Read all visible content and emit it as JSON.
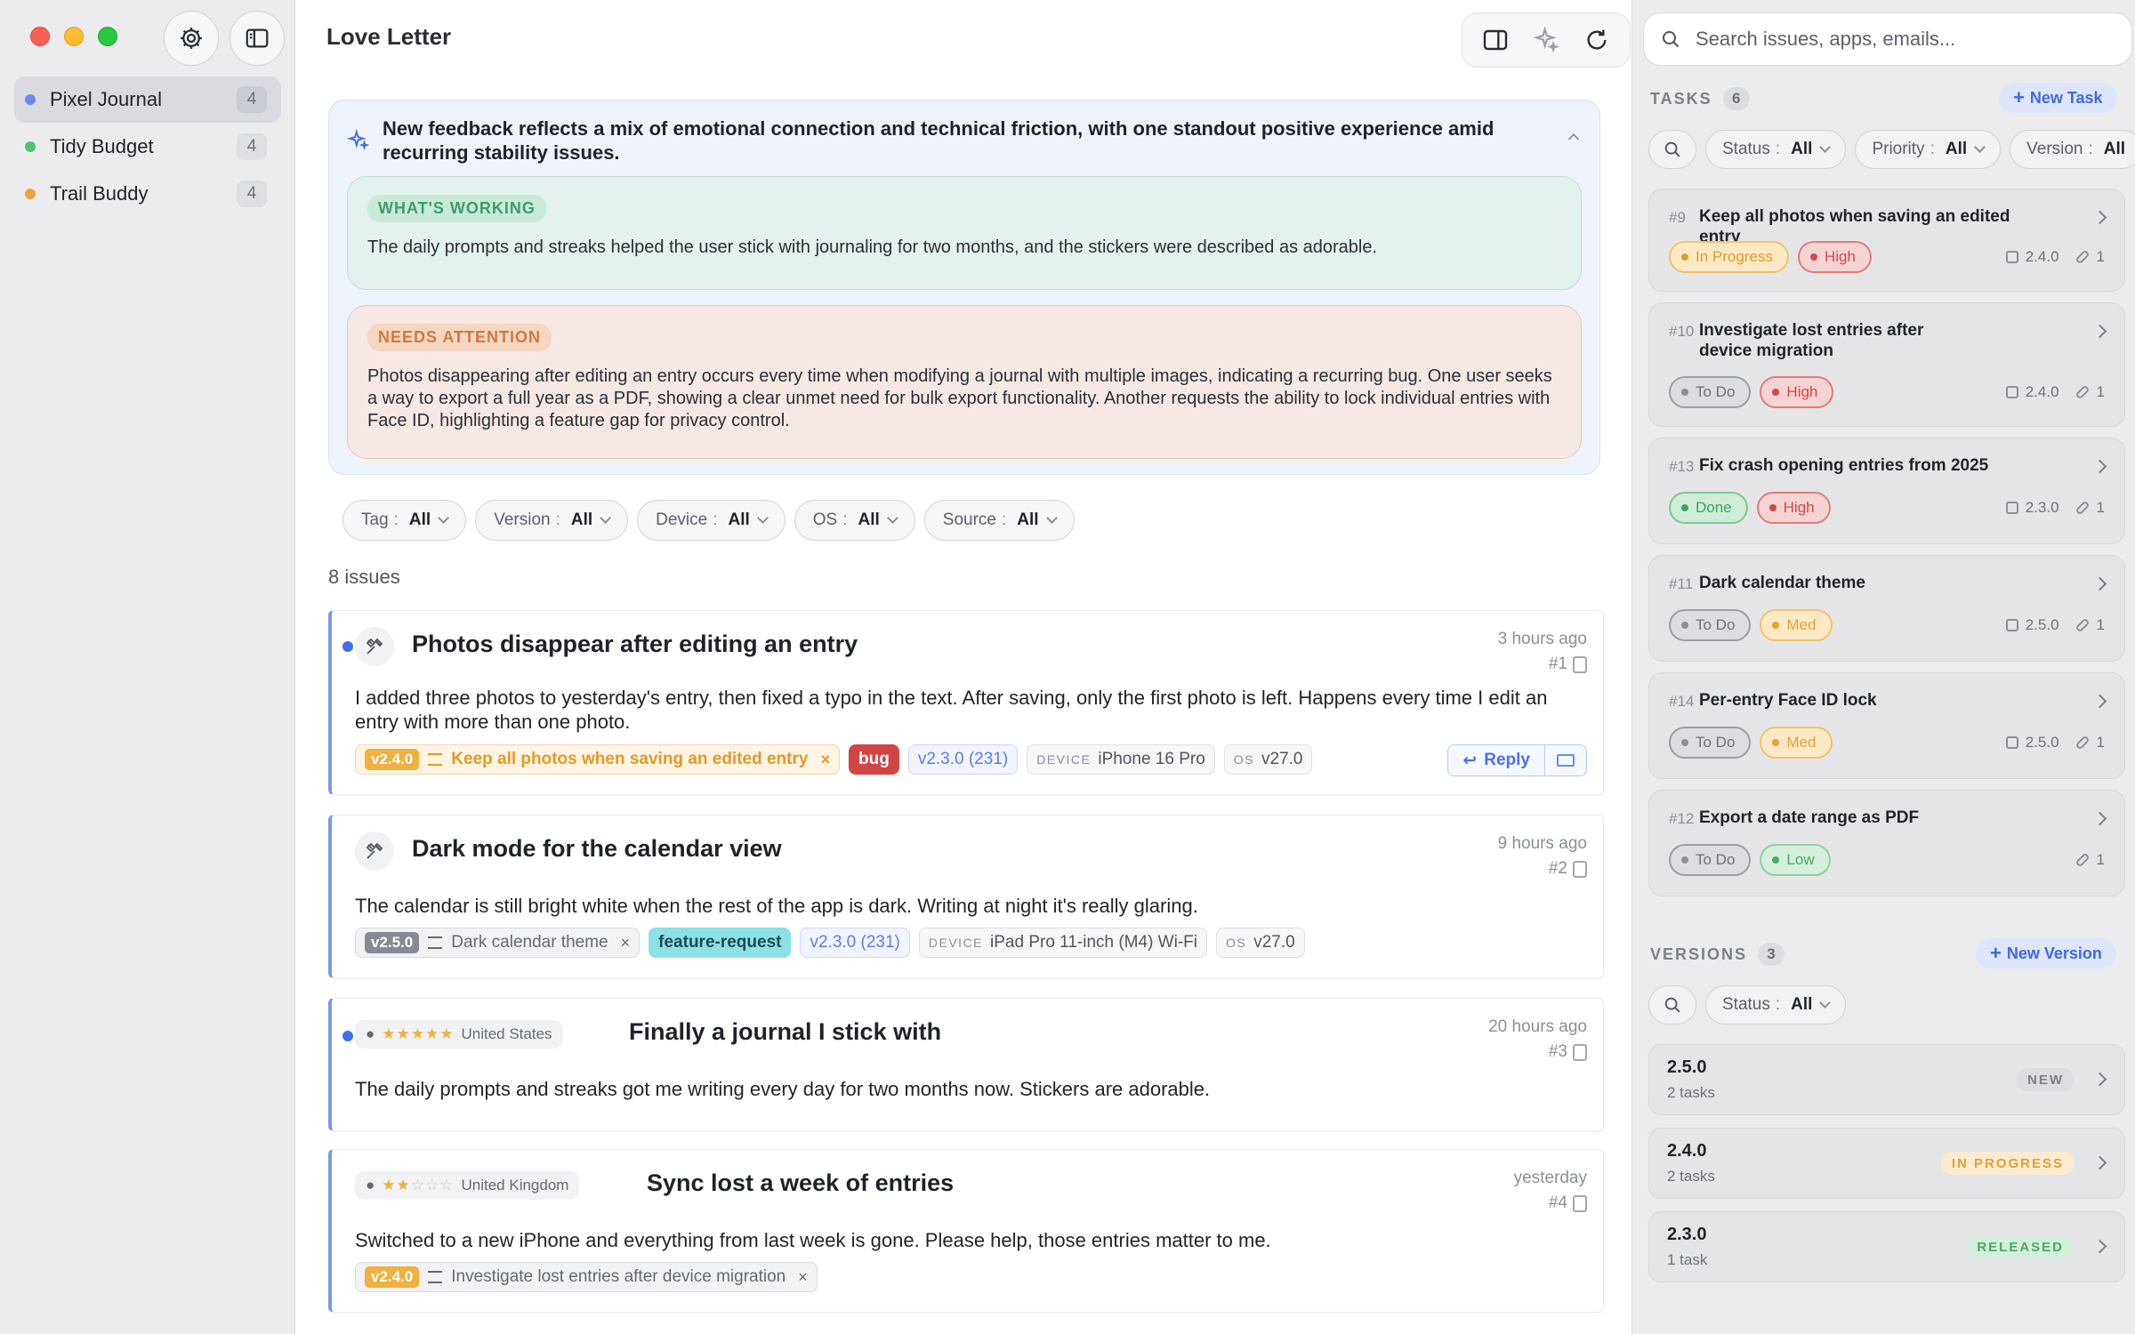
{
  "sidebar": {
    "apps": [
      {
        "name": "Pixel Journal",
        "count": "4",
        "color": "#6f86f0",
        "active": true
      },
      {
        "name": "Tidy Budget",
        "count": "4",
        "color": "#49c47a",
        "active": false
      },
      {
        "name": "Trail Buddy",
        "count": "4",
        "color": "#f3a13f",
        "active": false
      }
    ]
  },
  "main": {
    "title": "Love Letter",
    "summary": {
      "headline": "New feedback reflects a mix of emotional connection and technical friction, with one standout positive experience amid recurring stability issues.",
      "working_label": "WHAT'S WORKING",
      "working_text": "The daily prompts and streaks helped the user stick with journaling for two months, and the stickers were described as adorable.",
      "attention_label": "NEEDS ATTENTION",
      "attention_text": "Photos disappearing after editing an entry occurs every time when modifying a journal with multiple images, indicating a recurring bug. One user seeks a way to export a full year as a PDF, showing a clear unmet need for bulk export functionality. Another requests the ability to lock individual entries with Face ID, highlighting a feature gap for privacy control."
    },
    "filters": [
      {
        "label": "Tag",
        "value": "All"
      },
      {
        "label": "Version",
        "value": "All"
      },
      {
        "label": "Device",
        "value": "All"
      },
      {
        "label": "OS",
        "value": "All"
      },
      {
        "label": "Source",
        "value": "All"
      }
    ],
    "issue_count": "8 issues",
    "issues": [
      {
        "title": "Photos disappear after editing an entry",
        "time": "3 hours ago",
        "num": "#1",
        "body": "I added three photos to yesterday's entry, then fixed a typo in the text. After saving, only the first photo is left. Happens every time I edit an entry with more than one photo.",
        "version": "v2.4.0",
        "task": "Keep all photos when saving an edited entry",
        "tag": "bug",
        "build": "v2.3.0 (231)",
        "device_key": "DEVICE",
        "device": "iPhone 16 Pro",
        "os_key": "OS",
        "os": "v27.0",
        "reply": "Reply"
      },
      {
        "title": "Dark mode for the calendar view",
        "time": "9 hours ago",
        "num": "#2",
        "body": "The calendar is still bright white when the rest of the app is dark. Writing at night it's really glaring.",
        "version": "v2.5.0",
        "task": "Dark calendar theme",
        "tag": "feature-request",
        "build": "v2.3.0 (231)",
        "device_key": "DEVICE",
        "device": "iPad Pro 11-inch (M4) Wi-Fi",
        "os_key": "OS",
        "os": "v27.0"
      },
      {
        "title": "Finally a journal I stick with",
        "time": "20 hours ago",
        "num": "#3",
        "stars_on": "★★★★★",
        "stars_off": "",
        "country": "United States",
        "body": "The daily prompts and streaks got me writing every day for two months now. Stickers are adorable."
      },
      {
        "title": "Sync lost a week of entries",
        "time": "yesterday",
        "num": "#4",
        "stars_on": "★★",
        "stars_off": "☆☆☆",
        "country": "United Kingdom",
        "body": "Switched to a new iPhone and everything from last week is gone. Please help, those entries matter to me.",
        "version": "v2.4.0",
        "task": "Investigate lost entries after device migration"
      }
    ]
  },
  "right": {
    "search_placeholder": "Search issues, apps, emails...",
    "tasks_label": "TASKS",
    "tasks_count": "6",
    "new_task": "New Task",
    "task_filters": [
      {
        "label": "Status",
        "value": "All"
      },
      {
        "label": "Priority",
        "value": "All"
      },
      {
        "label": "Version",
        "value": "All"
      }
    ],
    "tasks": [
      {
        "num": "#9",
        "title": "Keep all photos when saving an edited entry",
        "status": "In Progress",
        "priority": "High",
        "version": "2.4.0",
        "links": "1"
      },
      {
        "num": "#10",
        "title": "Investigate lost entries after device migration",
        "status": "To Do",
        "priority": "High",
        "version": "2.4.0",
        "links": "1"
      },
      {
        "num": "#13",
        "title": "Fix crash opening entries from 2025",
        "status": "Done",
        "priority": "High",
        "version": "2.3.0",
        "links": "1"
      },
      {
        "num": "#11",
        "title": "Dark calendar theme",
        "status": "To Do",
        "priority": "Med",
        "version": "2.5.0",
        "links": "1"
      },
      {
        "num": "#14",
        "title": "Per-entry Face ID lock",
        "status": "To Do",
        "priority": "Med",
        "version": "2.5.0",
        "links": "1"
      },
      {
        "num": "#12",
        "title": "Export a date range as PDF",
        "status": "To Do",
        "priority": "Low",
        "version": "",
        "links": "1"
      }
    ],
    "versions_label": "VERSIONS",
    "versions_count": "3",
    "new_version": "New Version",
    "version_filter": {
      "label": "Status",
      "value": "All"
    },
    "versions": [
      {
        "name": "2.5.0",
        "tasks": "2 tasks",
        "badge": "NEW"
      },
      {
        "name": "2.4.0",
        "tasks": "2 tasks",
        "badge": "IN PROGRESS"
      },
      {
        "name": "2.3.0",
        "tasks": "1 task",
        "badge": "RELEASED"
      }
    ]
  }
}
